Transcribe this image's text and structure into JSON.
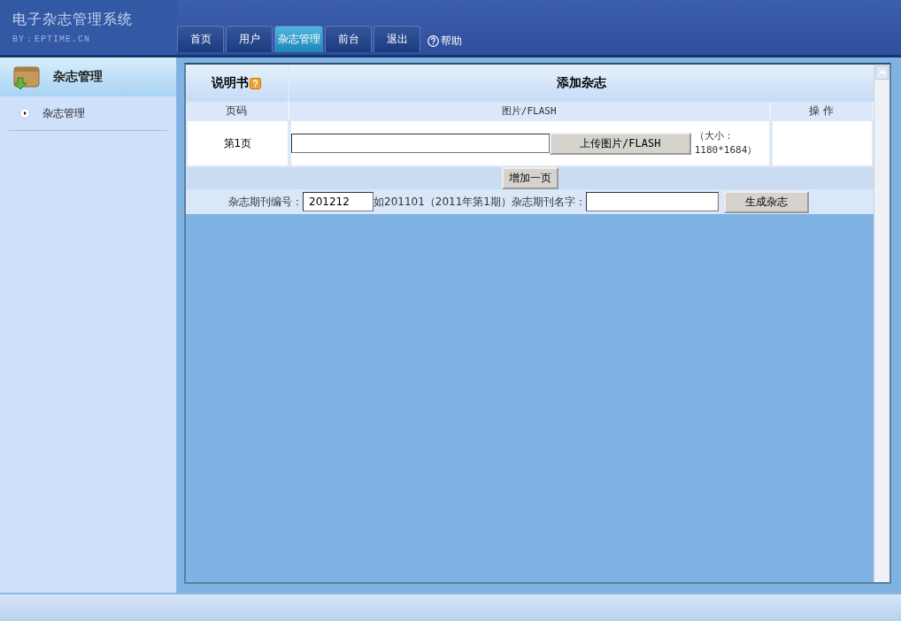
{
  "app": {
    "title": "电子杂志管理系统",
    "subtitle": "BY：EPTIME.CN"
  },
  "nav_tabs": [
    {
      "label": "首页",
      "selected": false
    },
    {
      "label": "用户",
      "selected": false
    },
    {
      "label": "杂志管理",
      "selected": true
    },
    {
      "label": "前台",
      "selected": false
    },
    {
      "label": "退出",
      "selected": false
    }
  ],
  "help_link": "帮助",
  "sidebar": {
    "title": "杂志管理",
    "items": [
      {
        "label": "杂志管理"
      }
    ]
  },
  "panel": {
    "manual_label": "说明书",
    "title": "添加杂志",
    "columns": [
      "页码",
      "图片/FLASH",
      "操 作"
    ],
    "rows": [
      {
        "page": "第1页",
        "upload_button": "上传图片/FLASH",
        "size_note": "（大小：1180*1684）"
      }
    ],
    "add_page_button": "增加一页",
    "issue_number_label": "杂志期刊编号：",
    "issue_number_value": "201212",
    "issue_number_hint": "如201101（2011年第1期）",
    "issue_name_label": "杂志期刊名字：",
    "generate_button": "生成杂志"
  }
}
